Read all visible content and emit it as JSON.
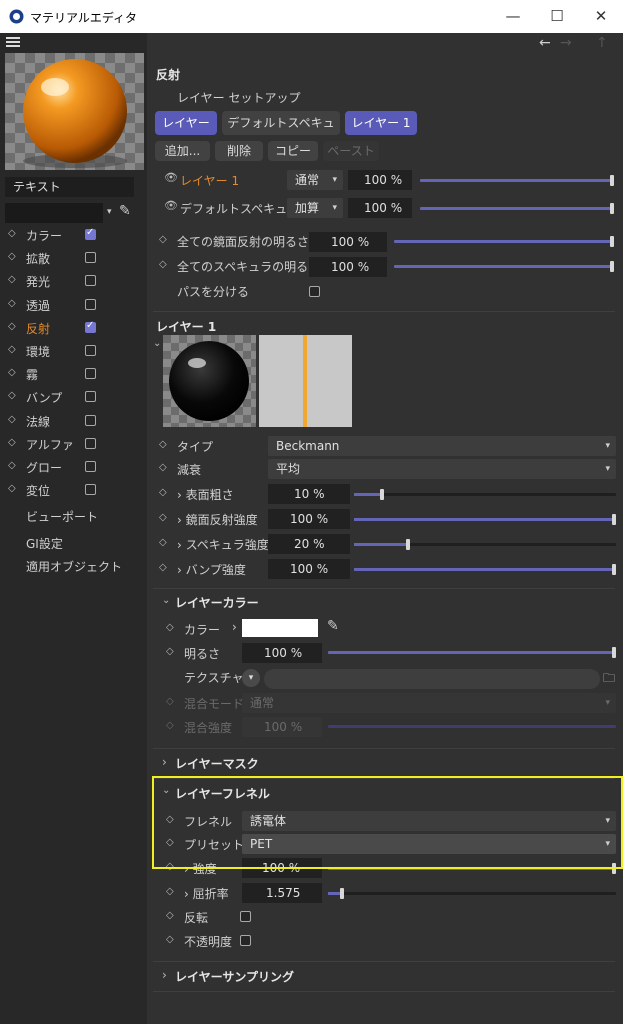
{
  "window": {
    "title": "マテリアルエディタ",
    "minimize": "—",
    "maximize": "☐",
    "close": "✕"
  },
  "nav": {
    "back": "←",
    "forward": "→",
    "up": "↑"
  },
  "left": {
    "name_field": "テキスト",
    "channels": [
      {
        "label": "カラー",
        "checked": true,
        "active": false
      },
      {
        "label": "拡散",
        "checked": false,
        "active": false
      },
      {
        "label": "発光",
        "checked": false,
        "active": false
      },
      {
        "label": "透過",
        "checked": false,
        "active": false
      },
      {
        "label": "反射",
        "checked": true,
        "active": true
      },
      {
        "label": "環境",
        "checked": false,
        "active": false
      },
      {
        "label": "霧",
        "checked": false,
        "active": false
      },
      {
        "label": "バンプ",
        "checked": false,
        "active": false
      },
      {
        "label": "法線",
        "checked": false,
        "active": false
      },
      {
        "label": "アルファ",
        "checked": false,
        "active": false
      },
      {
        "label": "グロー",
        "checked": false,
        "active": false
      },
      {
        "label": "変位",
        "checked": false,
        "active": false
      }
    ],
    "links": [
      "ビューポート",
      "GI設定",
      "適用オブジェクト"
    ]
  },
  "reflection": {
    "title": "反射",
    "layer_setup": "レイヤー セットアップ",
    "tabs": [
      "レイヤー",
      "デフォルトスペキュラ",
      "レイヤー 1"
    ],
    "actions": [
      "追加...",
      "削除",
      "コピー",
      "ペースト"
    ],
    "layers": [
      {
        "label": "レイヤー 1",
        "mode": "通常",
        "value": "100 %"
      },
      {
        "label": "デフォルトスペキュラ",
        "mode": "加算",
        "value": "100 %"
      }
    ],
    "all_reflection_brightness": {
      "label": "全ての鏡面反射の明るさ",
      "value": "100 %"
    },
    "all_specular_brightness": {
      "label": "全てのスペキュラの明るさ",
      "value": "100 %"
    },
    "separate_pass": "パスを分ける"
  },
  "layer1": {
    "title": "レイヤー 1",
    "type": {
      "label": "タイプ",
      "value": "Beckmann"
    },
    "attenuation": {
      "label": "減衰",
      "value": "平均"
    },
    "roughness": {
      "label": "表面粗さ",
      "value": "10 %",
      "level": 0.1
    },
    "reflection_strength": {
      "label": "鏡面反射強度",
      "value": "100 %",
      "level": 1.0
    },
    "specular_strength": {
      "label": "スペキュラ強度",
      "value": "20 %",
      "level": 0.2
    },
    "bump_strength": {
      "label": "バンプ強度",
      "value": "100 %",
      "level": 1.0
    }
  },
  "layer_color": {
    "title": "レイヤーカラー",
    "color": {
      "label": "カラー",
      "value": "#ffffff"
    },
    "brightness": {
      "label": "明るさ",
      "value": "100 %"
    },
    "texture": {
      "label": "テクスチャ"
    },
    "blend_mode": {
      "label": "混合モード",
      "value": "通常"
    },
    "blend_strength": {
      "label": "混合強度",
      "value": "100 %"
    }
  },
  "layer_mask": {
    "title": "レイヤーマスク"
  },
  "layer_fresnel": {
    "title": "レイヤーフレネル",
    "fresnel": {
      "label": "フレネル",
      "value": "誘電体"
    },
    "preset": {
      "label": "プリセット",
      "value": "PET"
    },
    "strength": {
      "label": "強度",
      "value": "100 %"
    },
    "ior": {
      "label": "屈折率",
      "value": "1.575"
    },
    "invert": "反転",
    "opacity": "不透明度"
  },
  "layer_sampling": {
    "title": "レイヤーサンプリング"
  },
  "colors": {
    "accent": "#5a5ab8",
    "active_channel": "#e38a2c",
    "highlight": "#f0f020"
  }
}
